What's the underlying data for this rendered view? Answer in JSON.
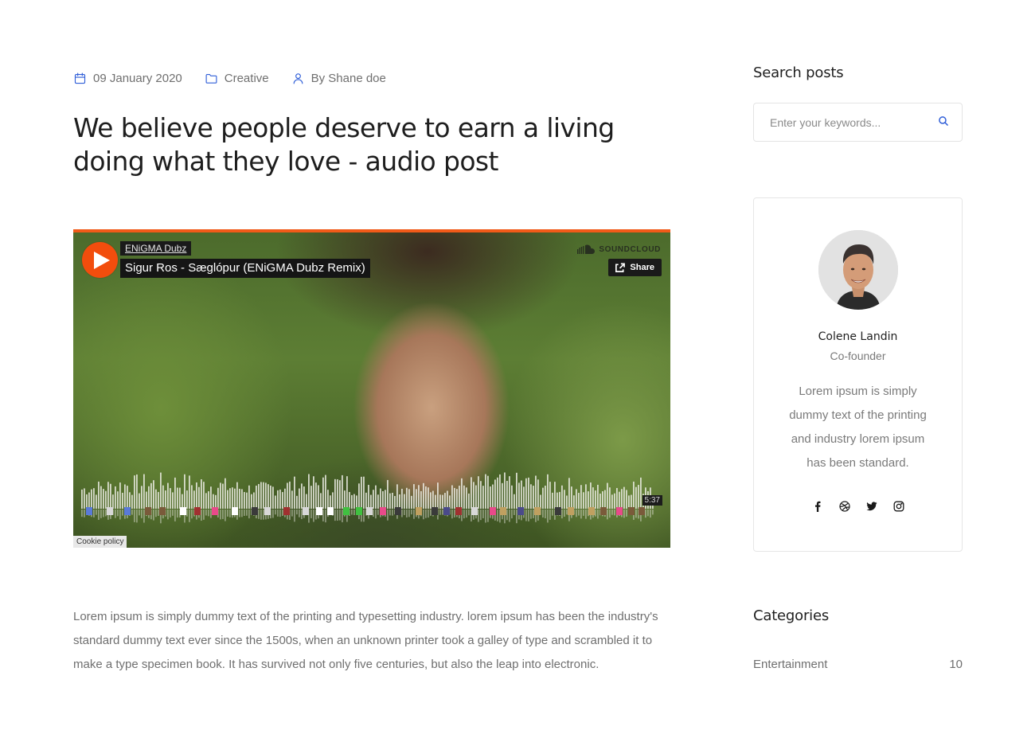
{
  "post": {
    "meta": {
      "date": "09 January 2020",
      "category": "Creative",
      "author": "By Shane doe"
    },
    "title": "We believe people deserve to earn a living doing what they love - audio post",
    "body": "Lorem ipsum is simply dummy text of the printing and typesetting industry. lorem ipsum has been the industry's standard dummy text ever since the 1500s, when an unknown printer took a galley of type and scrambled it to make a type specimen book. It has survived not only five centuries, but also the leap into electronic."
  },
  "player": {
    "artist": "ENiGMA Dubz",
    "track": "Sigur Ros - Sæglópur (ENiGMA Dubz Remix)",
    "brand": "SOUNDCLOUD",
    "share_label": "Share",
    "duration": "5:37",
    "cookie_label": "Cookie policy",
    "accent_color": "#f24d0d"
  },
  "sidebar": {
    "search": {
      "title": "Search posts",
      "placeholder": "Enter your keywords..."
    },
    "author": {
      "name": "Colene Landin",
      "role": "Co-founder",
      "bio": "Lorem ipsum is simply dummy text of the printing and industry lorem ipsum has been standard.",
      "socials": [
        "facebook-icon",
        "dribbble-icon",
        "twitter-icon",
        "instagram-icon"
      ]
    },
    "categories": {
      "title": "Categories",
      "items": [
        {
          "label": "Entertainment",
          "count": "10"
        }
      ]
    }
  },
  "theme": {
    "accent": "#2f5ed8",
    "heading": "#1e1e1e",
    "muted": "#6f6f6f"
  }
}
